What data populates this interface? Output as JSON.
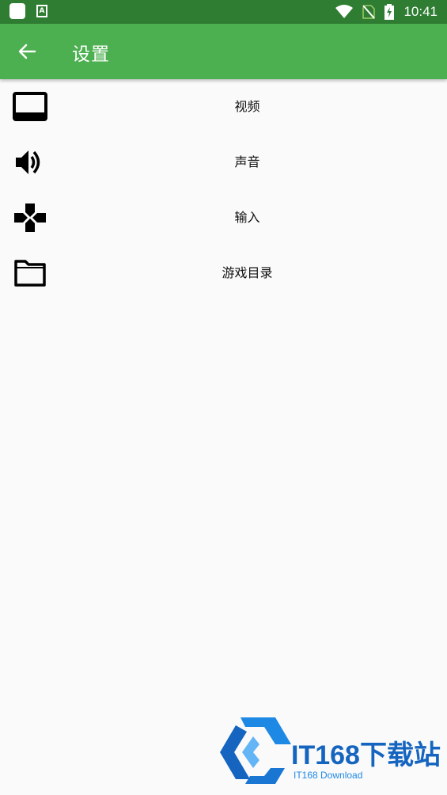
{
  "status_bar": {
    "time": "10:41",
    "icons": [
      "app-square-icon",
      "accessibility-a-icon",
      "wifi-icon",
      "no-sim-icon",
      "battery-charging-icon"
    ]
  },
  "app_bar": {
    "title": "设置",
    "back_icon": "arrow-back-icon"
  },
  "settings": {
    "items": [
      {
        "label": "视频",
        "icon": "monitor-icon"
      },
      {
        "label": "声音",
        "icon": "speaker-icon"
      },
      {
        "label": "输入",
        "icon": "gamepad-icon"
      },
      {
        "label": "游戏目录",
        "icon": "folder-icon"
      }
    ]
  },
  "watermark": {
    "logo_text": "IT168下载站",
    "sub_text": "IT168 Download"
  },
  "colors": {
    "status_bar": "#2e7d32",
    "app_bar": "#4caf50",
    "background": "#fafafa",
    "watermark_blue": "#1565c0"
  }
}
